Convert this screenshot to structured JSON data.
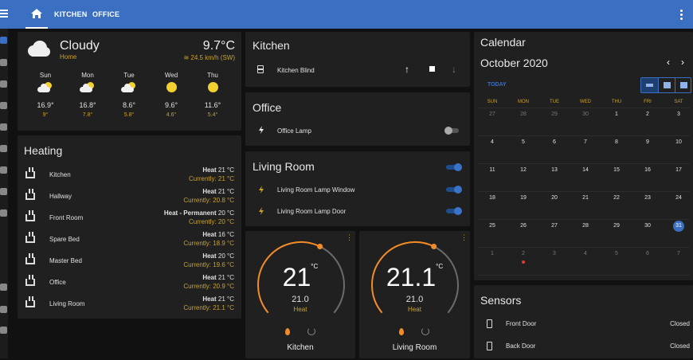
{
  "header": {
    "tabs": [
      "KITCHEN",
      "OFFICE"
    ]
  },
  "sidebar": {
    "icons": [
      "overview-icon",
      "account-box-icon",
      "list-icon",
      "chart-icon",
      "inbox-icon",
      "terminal-icon",
      "calendar-icon",
      "compass-icon",
      "media-icon",
      "hammer-icon",
      "cog-badge-icon",
      "settings-icon"
    ]
  },
  "weather": {
    "condition": "Cloudy",
    "location": "Home",
    "temperature": "9.7°C",
    "wind": "24.5 km/h (SW)",
    "forecast": [
      {
        "day": "Sun",
        "icon": "partly-cloudy-icon",
        "high": "16.9°",
        "low": "9°"
      },
      {
        "day": "Mon",
        "icon": "partly-cloudy-icon",
        "high": "16.8°",
        "low": "7.8°"
      },
      {
        "day": "Tue",
        "icon": "partly-cloudy-icon",
        "high": "8.6°",
        "low": "5.8°"
      },
      {
        "day": "Wed",
        "icon": "sunny-icon",
        "high": "9.6°",
        "low": "4.6°"
      },
      {
        "day": "Thu",
        "icon": "sunny-icon",
        "high": "11.6°",
        "low": "5.4°"
      }
    ]
  },
  "heating": {
    "title": "Heating",
    "rooms": [
      {
        "name": "Kitchen",
        "set_label": "Heat",
        "set_temp": "21 °C",
        "current": "Currently: 21 °C"
      },
      {
        "name": "Hallway",
        "set_label": "Heat",
        "set_temp": "21 °C",
        "current": "Currently: 20.8 °C"
      },
      {
        "name": "Front Room",
        "set_label": "Heat - Permanent",
        "set_temp": "20 °C",
        "current": "Currently: 20 °C"
      },
      {
        "name": "Spare Bed",
        "set_label": "Heat",
        "set_temp": "16 °C",
        "current": "Currently: 18.9 °C"
      },
      {
        "name": "Master Bed",
        "set_label": "Heat",
        "set_temp": "20 °C",
        "current": "Currently: 19.6 °C"
      },
      {
        "name": "Office",
        "set_label": "Heat",
        "set_temp": "21 °C",
        "current": "Currently: 20.9 °C"
      },
      {
        "name": "Living Room",
        "set_label": "Heat",
        "set_temp": "21 °C",
        "current": "Currently: 21.1 °C"
      }
    ]
  },
  "kitchen": {
    "title": "Kitchen",
    "blind_label": "Kitchen Blind"
  },
  "office": {
    "title": "Office",
    "lamp_label": "Office Lamp",
    "lamp_on": false
  },
  "living_room": {
    "title": "Living Room",
    "lamp_window": "Living Room Lamp Window",
    "lamp_door": "Living Room Lamp Door"
  },
  "thermostats": [
    {
      "temp": "21",
      "unit": "°C",
      "target": "21.0",
      "mode": "Heat",
      "name": "Kitchen",
      "level": 0.6
    },
    {
      "temp": "21.1",
      "unit": "°C",
      "target": "21.0",
      "mode": "Heat",
      "name": "Living Room",
      "level": 0.6
    }
  ],
  "calendar": {
    "title": "Calendar",
    "month": "October 2020",
    "today_label": "TODAY",
    "weekdays": [
      "SUN",
      "MON",
      "TUE",
      "WED",
      "THU",
      "FRI",
      "SAT"
    ],
    "weeks": [
      [
        "27",
        "28",
        "29",
        "30",
        "1",
        "2",
        "3"
      ],
      [
        "4",
        "5",
        "6",
        "7",
        "8",
        "9",
        "10"
      ],
      [
        "11",
        "12",
        "13",
        "14",
        "15",
        "16",
        "17"
      ],
      [
        "18",
        "19",
        "20",
        "21",
        "22",
        "23",
        "24"
      ],
      [
        "25",
        "26",
        "27",
        "28",
        "29",
        "30",
        "31"
      ],
      [
        "1",
        "2",
        "3",
        "4",
        "5",
        "6",
        "7"
      ]
    ],
    "today": "31"
  },
  "sensors": {
    "title": "Sensors",
    "items": [
      {
        "name": "Front Door",
        "state": "Closed"
      },
      {
        "name": "Back Door",
        "state": "Closed"
      }
    ]
  },
  "colors": {
    "accent": "#3a6fc2",
    "heat": "#f28c28",
    "muted_gold": "#c9a227"
  }
}
